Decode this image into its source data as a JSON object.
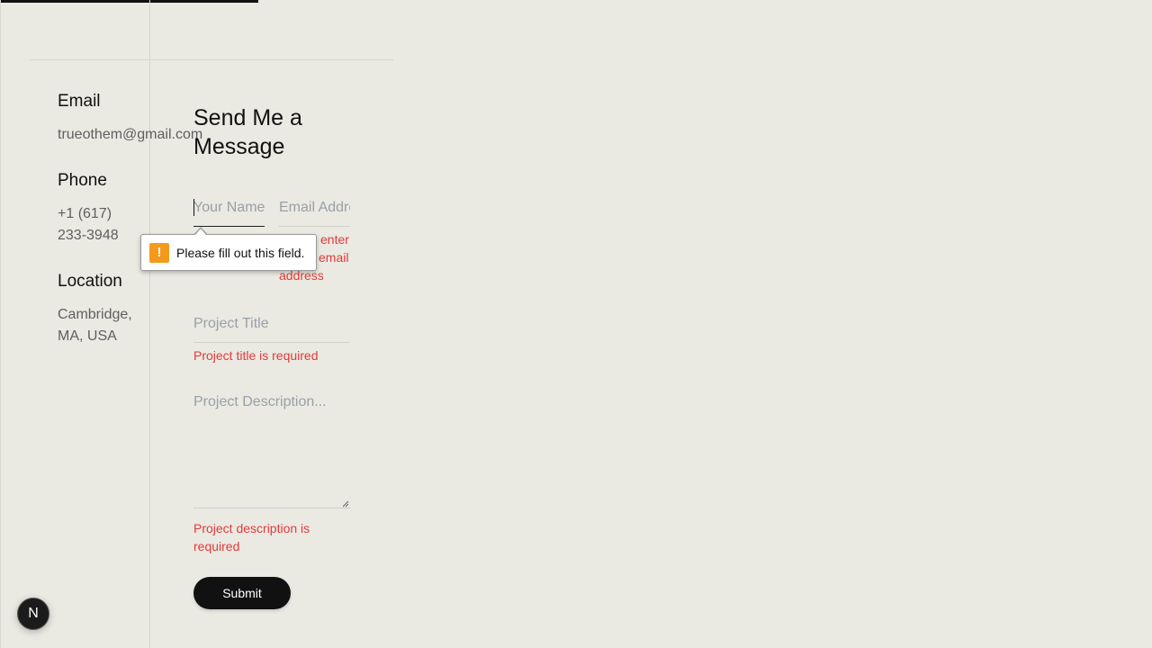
{
  "contact": {
    "email_heading": "Email",
    "email_value": "trueothem@gmail.com",
    "phone_heading": "Phone",
    "phone_line1": "+1 (617)",
    "phone_line2": "233-3948",
    "location_heading": "Location",
    "location_line1": "Cambridge,",
    "location_line2": "MA, USA"
  },
  "form": {
    "title": "Send Me a Message",
    "name_placeholder": "Your Name",
    "email_placeholder": "Email Address",
    "email_error_line1": "enter",
    "email_error_line2": "email",
    "email_error_line3": "address",
    "project_title_placeholder": "Project Title",
    "project_title_error": "Project title is required",
    "project_description_placeholder": "Project Description...",
    "project_description_error": "Project description is required",
    "submit_label": "Submit"
  },
  "tooltip": {
    "message": "Please fill out this field.",
    "icon": "warning-icon",
    "icon_glyph": "!"
  },
  "badge": {
    "label": "N",
    "icon": "nextjs-logo-icon"
  },
  "colors": {
    "background": "#eae9e2",
    "error": "#e03b3b",
    "button": "#111111",
    "tooltip_icon": "#f39a1d"
  }
}
